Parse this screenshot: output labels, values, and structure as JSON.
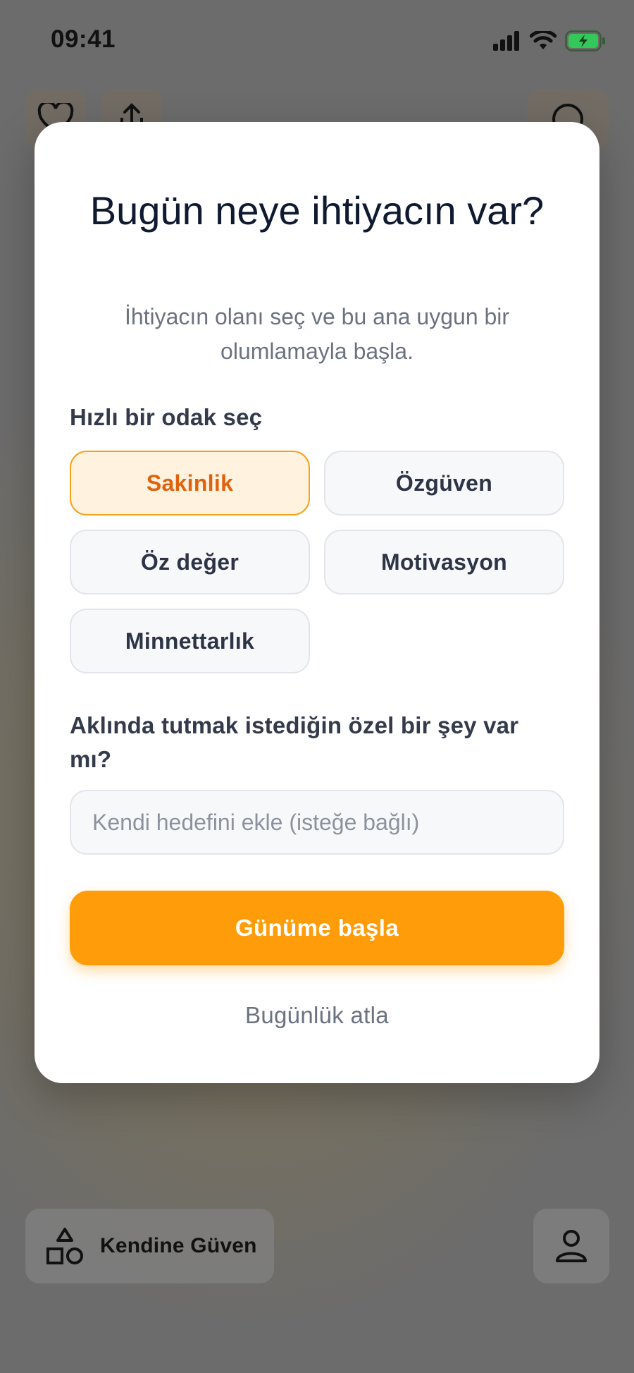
{
  "status_bar": {
    "time": "09:41"
  },
  "modal": {
    "title": "Bugün neye ihtiyacın var?",
    "subtitle": "İhtiyacın olanı seç ve bu ana uygun bir olumlamayla başla.",
    "focus_label": "Hızlı bir odak seç",
    "focus_options": [
      {
        "label": "Sakinlik",
        "selected": true
      },
      {
        "label": "Özgüven",
        "selected": false
      },
      {
        "label": "Öz değer",
        "selected": false
      },
      {
        "label": "Motivasyon",
        "selected": false
      },
      {
        "label": "Minnettarlık",
        "selected": false
      }
    ],
    "question": "Aklında tutmak istediğin özel bir şey var mı?",
    "goal_input": {
      "value": "",
      "placeholder": "Kendi hedefini ekle (isteğe bağlı)"
    },
    "start_button": "Günüme başla",
    "skip_link": "Bugünlük atla"
  },
  "background": {
    "category_label": "Kendine Güven",
    "icons": [
      "heart-icon",
      "share-icon",
      "plus-icon",
      "shapes-icon",
      "profile-icon"
    ]
  },
  "colors": {
    "accent": "#ff9c0a",
    "selected_bg": "#fff3e0",
    "selected_text": "#e0620f",
    "battery": "#34c759"
  }
}
